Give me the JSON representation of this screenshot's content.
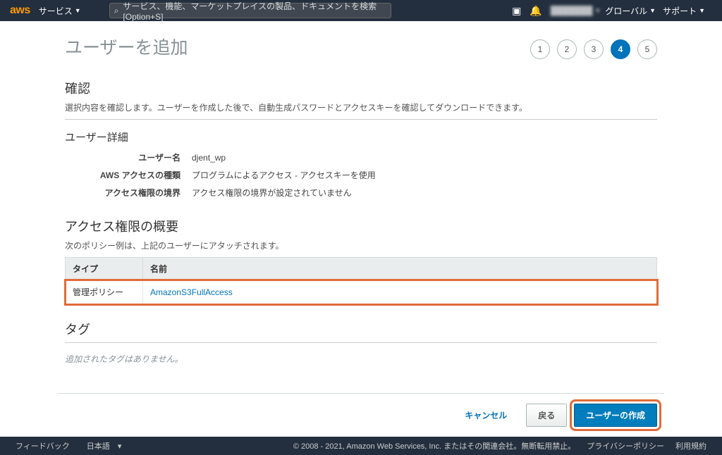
{
  "nav": {
    "logo": "aws",
    "services": "サービス",
    "search_placeholder": "サービス、機能、マーケットプレイスの製品、ドキュメントを検索  [Option+S]",
    "region": "グローバル",
    "support": "サポート"
  },
  "page": {
    "title": "ユーザーを追加",
    "steps": [
      "1",
      "2",
      "3",
      "4",
      "5"
    ],
    "active_step": 4
  },
  "confirm": {
    "heading": "確認",
    "desc": "選択内容を確認します。ユーザーを作成した後で、自動生成パスワードとアクセスキーを確認してダウンロードできます。"
  },
  "user_details": {
    "heading": "ユーザー詳細",
    "rows": [
      {
        "label": "ユーザー名",
        "value": "djent_wp"
      },
      {
        "label": "AWS アクセスの種類",
        "value": "プログラムによるアクセス - アクセスキーを使用"
      },
      {
        "label": "アクセス権限の境界",
        "value": "アクセス権限の境界が設定されていません"
      }
    ]
  },
  "permissions": {
    "heading": "アクセス権限の概要",
    "desc": "次のポリシー例は、上記のユーザーにアタッチされます。",
    "columns": {
      "type": "タイプ",
      "name": "名前"
    },
    "rows": [
      {
        "type": "管理ポリシー",
        "name": "AmazonS3FullAccess"
      }
    ]
  },
  "tags": {
    "heading": "タグ",
    "empty": "追加されたタグはありません。"
  },
  "actions": {
    "cancel": "キャンセル",
    "back": "戻る",
    "create": "ユーザーの作成"
  },
  "footer": {
    "feedback": "フィードバック",
    "lang": "日本語",
    "copyright": "© 2008 - 2021, Amazon Web Services, Inc. またはその関連会社。無断転用禁止。",
    "privacy": "プライバシーポリシー",
    "terms": "利用規約"
  }
}
